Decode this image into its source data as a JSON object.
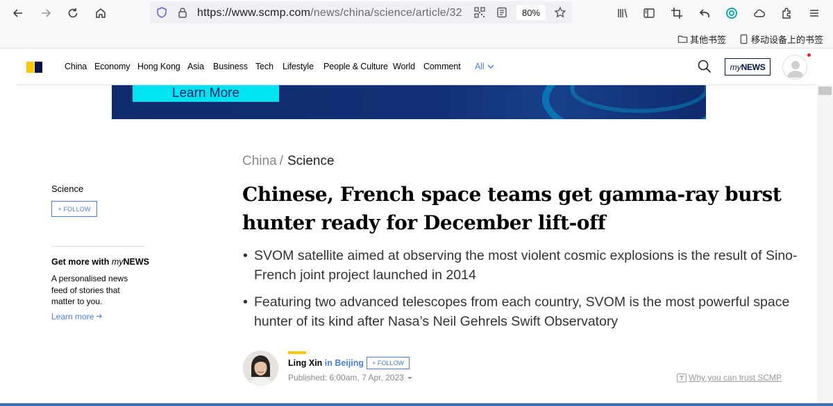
{
  "browser": {
    "url_host": "https://www.scmp.com",
    "url_path": "/news/china/science/article/32",
    "zoom": "80%",
    "bookmarks": [
      {
        "label": "其他书签"
      },
      {
        "label": "移动设备上的书签"
      }
    ]
  },
  "site": {
    "nav": [
      "China",
      "Economy",
      "Hong Kong",
      "Asia",
      "Business",
      "Tech",
      "Lifestyle",
      "People & Culture",
      "World",
      "Comment"
    ],
    "nav_all": "All",
    "mynews_prefix": "my",
    "mynews_suffix": "NEWS",
    "brand_colors": {
      "yellow": "#ffc700",
      "navy": "#001246",
      "link": "#4a7de1"
    }
  },
  "ad": {
    "cta_label": "Learn More"
  },
  "sidebar": {
    "topic": "Science",
    "follow_label": "+ FOLLOW",
    "promo_title_prefix": "Get more with ",
    "promo_title_my": "my",
    "promo_title_news": "NEWS",
    "promo_text": "A personalised news feed of stories that matter to you.",
    "learn_more": "Learn more"
  },
  "article": {
    "breadcrumb": [
      "China",
      "Science"
    ],
    "breadcrumb_sep": "/",
    "headline": "Chinese, French space teams get gamma-ray burst hunter ready for December lift-off",
    "summary": [
      "SVOM satellite aimed at observing the most violent cosmic explosions is the result of Sino-French joint project launched in 2014",
      "Featuring two advanced telescopes from each country, SVOM is the most powerful space hunter of its kind after Nasa’s Neil Gehrels Swift Observatory"
    ],
    "author_name": "Ling Xin",
    "author_location": "in Beijing",
    "author_follow": "+ FOLLOW",
    "published": "Published: 6:00am, 7 Apr, 2023",
    "trust_link": "Why you can trust SCMP"
  }
}
